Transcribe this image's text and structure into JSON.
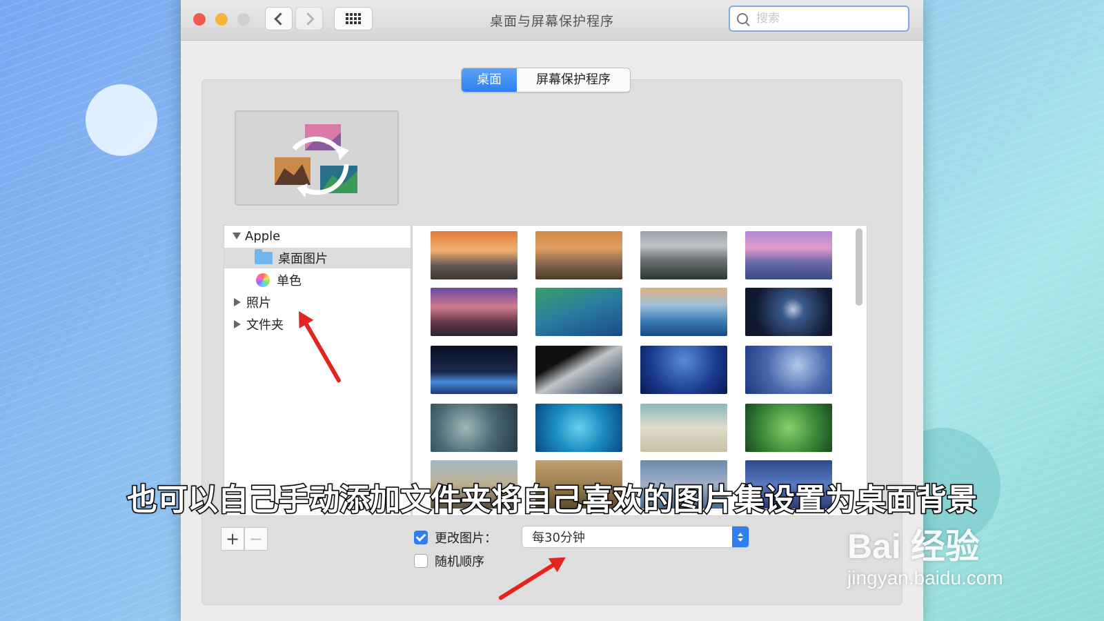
{
  "window": {
    "title": "桌面与屏幕保护程序",
    "search_placeholder": "搜索"
  },
  "tabs": [
    {
      "label": "桌面",
      "active": true
    },
    {
      "label": "屏幕保护程序",
      "active": false
    }
  ],
  "sidebar": {
    "groups": [
      {
        "label": "Apple",
        "expanded": true,
        "children": [
          {
            "label": "桌面图片",
            "selected": true,
            "icon": "folder-icon"
          },
          {
            "label": "单色",
            "selected": false,
            "icon": "color-wheel-icon"
          }
        ]
      },
      {
        "label": "照片",
        "expanded": false
      },
      {
        "label": "文件夹",
        "expanded": false
      }
    ]
  },
  "options": {
    "change_picture_label": "更改图片：",
    "change_picture_checked": true,
    "interval_value": "每30分钟",
    "random_order_label": "随机顺序",
    "random_order_checked": false
  },
  "buttons": {
    "add": "+",
    "remove": "−"
  },
  "caption": "也可以自己手动添加文件夹将自己喜欢的图片集设置为桌面背景",
  "watermark": {
    "brand": "Bai 经验",
    "url": "jingyan.baidu.com"
  },
  "colors": {
    "accent": "#2f7ff0",
    "arrow": "#e3241f"
  }
}
